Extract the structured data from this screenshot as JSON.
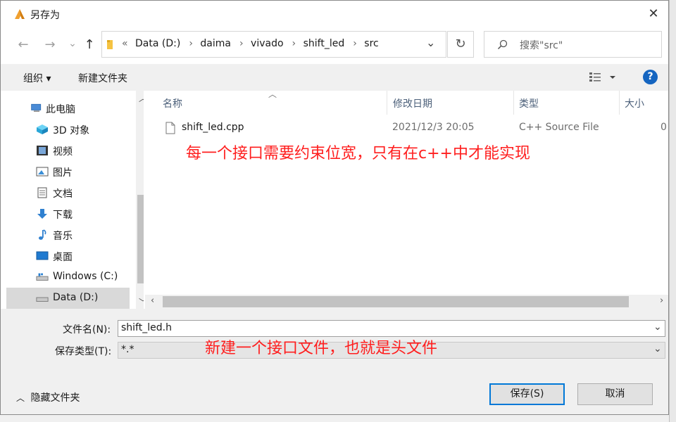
{
  "window": {
    "title": "另存为",
    "close_glyph": "✕"
  },
  "nav": {
    "back": "←",
    "forward": "→",
    "recent": "⌄",
    "up": "↑"
  },
  "address": {
    "overflow": "«",
    "segments": [
      "Data (D:)",
      "daima",
      "vivado",
      "shift_led",
      "src"
    ],
    "separator": "›",
    "dropdown": "⌄",
    "refresh": "↻"
  },
  "search": {
    "placeholder": "搜索\"src\"",
    "icon": "search-icon"
  },
  "toolbar": {
    "organize": "组织 ▾",
    "new_folder": "新建文件夹",
    "view": "view-icon",
    "help": "?"
  },
  "sidebar": {
    "items": [
      {
        "label": "此电脑",
        "icon": "computer-icon"
      },
      {
        "label": "3D 对象",
        "icon": "cube-icon"
      },
      {
        "label": "视频",
        "icon": "video-icon"
      },
      {
        "label": "图片",
        "icon": "picture-icon"
      },
      {
        "label": "文档",
        "icon": "document-icon"
      },
      {
        "label": "下载",
        "icon": "download-icon"
      },
      {
        "label": "音乐",
        "icon": "music-icon"
      },
      {
        "label": "桌面",
        "icon": "desktop-icon"
      },
      {
        "label": "Windows (C:)",
        "icon": "drive-icon"
      },
      {
        "label": "Data (D:)",
        "icon": "drive-icon"
      }
    ]
  },
  "columns": {
    "name": "名称",
    "date": "修改日期",
    "type": "类型",
    "size": "大小"
  },
  "files": [
    {
      "name": "shift_led.cpp",
      "date": "2021/12/3 20:05",
      "type": "C++ Source File",
      "size": "0"
    }
  ],
  "form": {
    "filename_label": "文件名(N):",
    "filename_value": "shift_led.h",
    "filetype_label": "保存类型(T):",
    "filetype_value": "*.*"
  },
  "footer": {
    "hide_folders": "隐藏文件夹",
    "save": "保存(S)",
    "cancel": "取消"
  },
  "annotations": {
    "note1": "每一个接口需要约束位宽，只有在c++中才能实现",
    "note2": "新建一个接口文件，也就是头文件"
  },
  "colors": {
    "accent": "#0078d7",
    "annotation": "#ff1e1e"
  }
}
